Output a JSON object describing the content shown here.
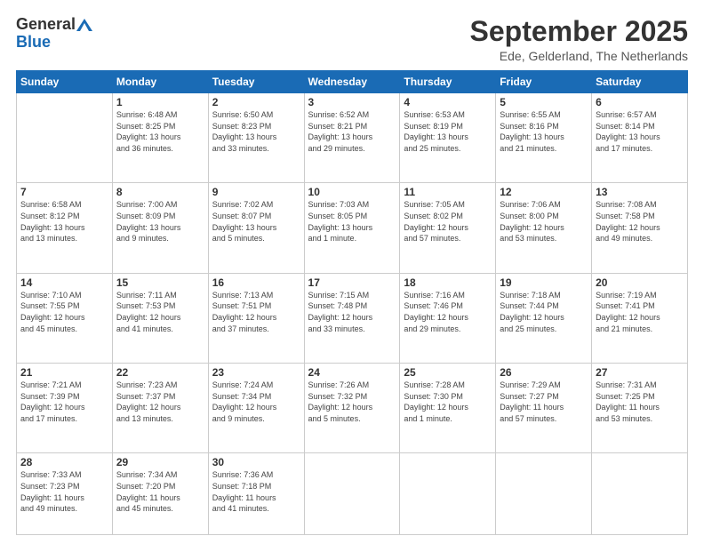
{
  "header": {
    "logo_general": "General",
    "logo_blue": "Blue",
    "title": "September 2025",
    "subtitle": "Ede, Gelderland, The Netherlands"
  },
  "days_of_week": [
    "Sunday",
    "Monday",
    "Tuesday",
    "Wednesday",
    "Thursday",
    "Friday",
    "Saturday"
  ],
  "weeks": [
    [
      {
        "num": "",
        "info": ""
      },
      {
        "num": "1",
        "info": "Sunrise: 6:48 AM\nSunset: 8:25 PM\nDaylight: 13 hours\nand 36 minutes."
      },
      {
        "num": "2",
        "info": "Sunrise: 6:50 AM\nSunset: 8:23 PM\nDaylight: 13 hours\nand 33 minutes."
      },
      {
        "num": "3",
        "info": "Sunrise: 6:52 AM\nSunset: 8:21 PM\nDaylight: 13 hours\nand 29 minutes."
      },
      {
        "num": "4",
        "info": "Sunrise: 6:53 AM\nSunset: 8:19 PM\nDaylight: 13 hours\nand 25 minutes."
      },
      {
        "num": "5",
        "info": "Sunrise: 6:55 AM\nSunset: 8:16 PM\nDaylight: 13 hours\nand 21 minutes."
      },
      {
        "num": "6",
        "info": "Sunrise: 6:57 AM\nSunset: 8:14 PM\nDaylight: 13 hours\nand 17 minutes."
      }
    ],
    [
      {
        "num": "7",
        "info": "Sunrise: 6:58 AM\nSunset: 8:12 PM\nDaylight: 13 hours\nand 13 minutes."
      },
      {
        "num": "8",
        "info": "Sunrise: 7:00 AM\nSunset: 8:09 PM\nDaylight: 13 hours\nand 9 minutes."
      },
      {
        "num": "9",
        "info": "Sunrise: 7:02 AM\nSunset: 8:07 PM\nDaylight: 13 hours\nand 5 minutes."
      },
      {
        "num": "10",
        "info": "Sunrise: 7:03 AM\nSunset: 8:05 PM\nDaylight: 13 hours\nand 1 minute."
      },
      {
        "num": "11",
        "info": "Sunrise: 7:05 AM\nSunset: 8:02 PM\nDaylight: 12 hours\nand 57 minutes."
      },
      {
        "num": "12",
        "info": "Sunrise: 7:06 AM\nSunset: 8:00 PM\nDaylight: 12 hours\nand 53 minutes."
      },
      {
        "num": "13",
        "info": "Sunrise: 7:08 AM\nSunset: 7:58 PM\nDaylight: 12 hours\nand 49 minutes."
      }
    ],
    [
      {
        "num": "14",
        "info": "Sunrise: 7:10 AM\nSunset: 7:55 PM\nDaylight: 12 hours\nand 45 minutes."
      },
      {
        "num": "15",
        "info": "Sunrise: 7:11 AM\nSunset: 7:53 PM\nDaylight: 12 hours\nand 41 minutes."
      },
      {
        "num": "16",
        "info": "Sunrise: 7:13 AM\nSunset: 7:51 PM\nDaylight: 12 hours\nand 37 minutes."
      },
      {
        "num": "17",
        "info": "Sunrise: 7:15 AM\nSunset: 7:48 PM\nDaylight: 12 hours\nand 33 minutes."
      },
      {
        "num": "18",
        "info": "Sunrise: 7:16 AM\nSunset: 7:46 PM\nDaylight: 12 hours\nand 29 minutes."
      },
      {
        "num": "19",
        "info": "Sunrise: 7:18 AM\nSunset: 7:44 PM\nDaylight: 12 hours\nand 25 minutes."
      },
      {
        "num": "20",
        "info": "Sunrise: 7:19 AM\nSunset: 7:41 PM\nDaylight: 12 hours\nand 21 minutes."
      }
    ],
    [
      {
        "num": "21",
        "info": "Sunrise: 7:21 AM\nSunset: 7:39 PM\nDaylight: 12 hours\nand 17 minutes."
      },
      {
        "num": "22",
        "info": "Sunrise: 7:23 AM\nSunset: 7:37 PM\nDaylight: 12 hours\nand 13 minutes."
      },
      {
        "num": "23",
        "info": "Sunrise: 7:24 AM\nSunset: 7:34 PM\nDaylight: 12 hours\nand 9 minutes."
      },
      {
        "num": "24",
        "info": "Sunrise: 7:26 AM\nSunset: 7:32 PM\nDaylight: 12 hours\nand 5 minutes."
      },
      {
        "num": "25",
        "info": "Sunrise: 7:28 AM\nSunset: 7:30 PM\nDaylight: 12 hours\nand 1 minute."
      },
      {
        "num": "26",
        "info": "Sunrise: 7:29 AM\nSunset: 7:27 PM\nDaylight: 11 hours\nand 57 minutes."
      },
      {
        "num": "27",
        "info": "Sunrise: 7:31 AM\nSunset: 7:25 PM\nDaylight: 11 hours\nand 53 minutes."
      }
    ],
    [
      {
        "num": "28",
        "info": "Sunrise: 7:33 AM\nSunset: 7:23 PM\nDaylight: 11 hours\nand 49 minutes."
      },
      {
        "num": "29",
        "info": "Sunrise: 7:34 AM\nSunset: 7:20 PM\nDaylight: 11 hours\nand 45 minutes."
      },
      {
        "num": "30",
        "info": "Sunrise: 7:36 AM\nSunset: 7:18 PM\nDaylight: 11 hours\nand 41 minutes."
      },
      {
        "num": "",
        "info": ""
      },
      {
        "num": "",
        "info": ""
      },
      {
        "num": "",
        "info": ""
      },
      {
        "num": "",
        "info": ""
      }
    ]
  ]
}
